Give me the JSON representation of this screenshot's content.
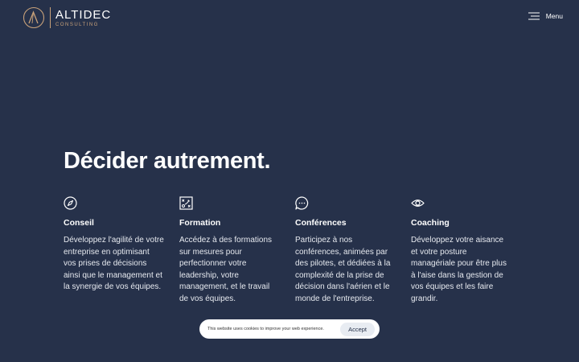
{
  "header": {
    "logo_name": "ALTIDEC",
    "logo_sub": "CONSULTING",
    "menu_label": "Menu"
  },
  "hero": {
    "title": "Décider autrement."
  },
  "services": [
    {
      "icon": "compass-icon",
      "title": "Conseil",
      "description": "Développez l'agilité de votre entreprise en optimisant vos prises de décisions ainsi que le management et la synergie de vos équipes."
    },
    {
      "icon": "strategy-board-icon",
      "title": "Formation",
      "description": "Accédez à des formations sur mesures pour perfectionner votre leadership, votre management, et le travail de vos équipes."
    },
    {
      "icon": "chat-bubble-icon",
      "title": "Conférences",
      "description": "Participez à nos conférences, animées par des pilotes, et dédiées à la complexité de la prise de décision dans l'aérien et le monde de l'entreprise."
    },
    {
      "icon": "eye-icon",
      "title": "Coaching",
      "description": "Développez votre aisance et votre posture managériale pour être plus à l'aise dans la gestion de vos équipes et les faire grandir."
    }
  ],
  "cookie": {
    "text": "This website uses cookies to improve your web experience.",
    "accept_label": "Accept"
  },
  "colors": {
    "background": "#26314a",
    "accent": "#c9a27a",
    "text": "#ffffff"
  }
}
